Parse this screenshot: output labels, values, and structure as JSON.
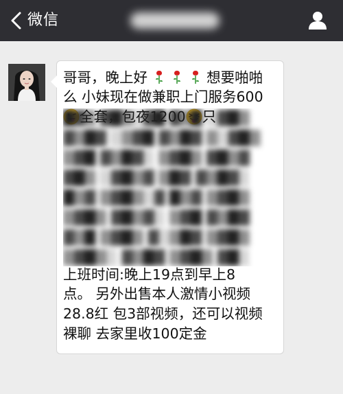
{
  "nav": {
    "back_label": "微信",
    "title": ""
  },
  "message": {
    "line1": "哥哥，晚上好",
    "line1_tail": "想要啪啪",
    "line2": "么 小妹现在做兼职上门服务600",
    "line3a": "全套，包夜1200",
    "line3b": "只",
    "line_after": [
      "上班时间:晚上19点到早上8",
      "点。 另外出售本人激情小视频",
      "28.8红 包3部视频，还可以视频",
      "裸聊 去家里收100定金"
    ]
  },
  "colors": {
    "navbar": "#2e2e33",
    "background": "#ededed",
    "bubble": "#ffffff",
    "rose": "#d61f1f"
  },
  "icons": {
    "back": "chevron-left-icon",
    "user": "user-icon",
    "rose": "rose-icon",
    "emoji_grin": "grinning-face-icon",
    "emoji_tongue": "tongue-out-face-icon"
  }
}
